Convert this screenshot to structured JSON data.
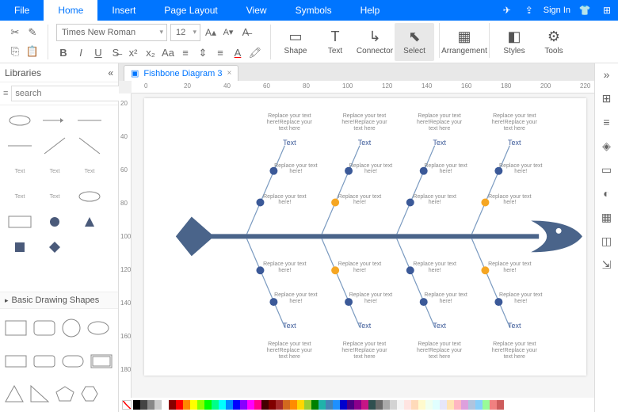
{
  "menu": {
    "items": [
      "File",
      "Home",
      "Insert",
      "Page Layout",
      "View",
      "Symbols",
      "Help"
    ],
    "active": 1,
    "signin": "Sign In"
  },
  "toolbar": {
    "font": "Times New Roman",
    "size": "12",
    "bigbtns": [
      {
        "label": "Shape",
        "icon": "▭"
      },
      {
        "label": "Text",
        "icon": "T"
      },
      {
        "label": "Connector",
        "icon": "↳"
      },
      {
        "label": "Select",
        "icon": "⬉",
        "sel": true
      },
      {
        "label": "Arrangement",
        "icon": "▦"
      },
      {
        "label": "Styles",
        "icon": "◧"
      },
      {
        "label": "Tools",
        "icon": "⚙"
      }
    ]
  },
  "left": {
    "title": "Libraries",
    "search_ph": "search",
    "section": "Basic Drawing Shapes"
  },
  "tab": {
    "name": "Fishbone Diagram 3"
  },
  "ruler_h": [
    0,
    20,
    40,
    60,
    80,
    100,
    120,
    140,
    160,
    180,
    200,
    220
  ],
  "ruler_v": [
    20,
    40,
    60,
    80,
    100,
    120,
    140,
    160,
    180
  ],
  "fish": {
    "bone_label": "Text",
    "sub_label": "Replace your text here!",
    "head_label": "Replace your text here!Replace your text here"
  },
  "colors": [
    "#000",
    "#444",
    "#888",
    "#ccc",
    "#fff",
    "#800",
    "#f00",
    "#f80",
    "#ff0",
    "#8f0",
    "#0f0",
    "#0f8",
    "#0ff",
    "#08f",
    "#00f",
    "#80f",
    "#f0f",
    "#f08",
    "#400",
    "#800000",
    "#a52a2a",
    "#d2691e",
    "#ff8c00",
    "#ffd700",
    "#9acd32",
    "#008000",
    "#20b2aa",
    "#4682b4",
    "#1e90ff",
    "#0000cd",
    "#4b0082",
    "#8b008b",
    "#c71585",
    "#2f4f4f",
    "#696969",
    "#a9a9a9",
    "#d3d3d3",
    "#f5f5f5",
    "#ffe4e1",
    "#ffdab9",
    "#fffacd",
    "#f0fff0",
    "#e0ffff",
    "#e6e6fa",
    "#ffe4b5",
    "#ffb6c1",
    "#dda0dd",
    "#b0c4de",
    "#87cefa",
    "#98fb98",
    "#f08080",
    "#cd5c5c"
  ]
}
